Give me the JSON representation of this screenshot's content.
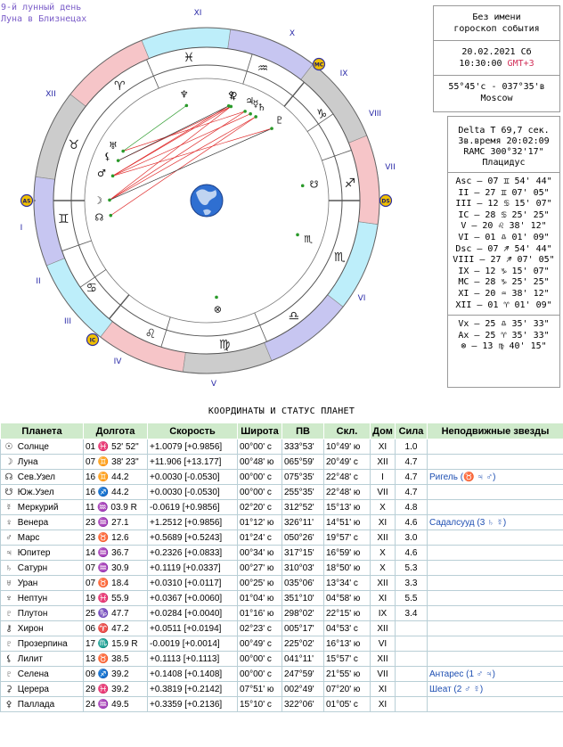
{
  "lunar_day": "9-й лунный день",
  "moon_sign": "Луна в Близнецах",
  "event": {
    "name_line1": "Без имени",
    "name_line2": "гороскоп события",
    "date": "20.02.2021 Сб",
    "time": "10:30:00",
    "tz": "GMT+3",
    "coords": "55°45'c - 037°35'в",
    "city": "Moscow"
  },
  "info": {
    "delta_t": "Delta T  69,7 сек.",
    "sidereal": "Зв.время 20:02:09",
    "ramc": "RAMC 300°32'17\"",
    "system": "Плацидус",
    "cusps": [
      "Asc – 07 ♊ 54' 44\"",
      "II – 27 ♊ 07' 05\"",
      "III – 12 ♋ 15' 07\"",
      "IC – 28 ♋ 25' 25\"",
      "V – 20 ♌ 38' 12\"",
      "VI – 01 ♎ 01' 09\"",
      "Dsc – 07 ♐ 54' 44\"",
      "VIII – 27 ♐ 07' 05\"",
      "IX – 12 ♑ 15' 07\"",
      "MC – 28 ♑ 25' 25\"",
      "XI – 20 ♒ 38' 12\"",
      "XII – 01 ♈ 01' 09\""
    ],
    "extra": [
      "Vx – 25 ♎ 35' 33\"",
      "Ax – 25 ♈ 35' 33\"",
      "⊗ – 13 ♍ 40' 15\""
    ]
  },
  "chart": {
    "house_numerals": [
      "XI",
      "X",
      "IX",
      "VIII",
      "VII",
      "VI",
      "V",
      "IV",
      "III",
      "II",
      "I",
      "XII"
    ],
    "axis_labels": {
      "asc": "AS",
      "dsc": "DS",
      "mc": "MC",
      "ic": "IC"
    },
    "colors": {
      "fire": "#f6c5c8",
      "earth": "#cccccc",
      "air": "#c7c6f1",
      "water": "#bdeefa",
      "accent": "#f0c000",
      "aspect_red": "#e03030",
      "aspect_black": "#333333",
      "aspect_green": "#2a9a2a",
      "numeral": "#2a2aa8"
    }
  },
  "table_title": "КООРДИНАТЫ И СТАТУС ПЛАНЕТ",
  "columns": [
    "Планета",
    "Долгота",
    "Скорость",
    "Широта",
    "ПВ",
    "Скл.",
    "Дом",
    "Сила",
    "Неподвижные звезды"
  ],
  "planets": [
    {
      "glyph": "☉",
      "name": "Солнце",
      "lon": "01 ♓ 52' 52\"",
      "speed": "+1.0079 [+0.9856]",
      "lat": "00°00' с",
      "ra": "333°53'",
      "decl": "10°49' ю",
      "house": "XI",
      "power": "1.0",
      "stars": ""
    },
    {
      "glyph": "☽",
      "name": "Луна",
      "lon": "07 ♊ 38' 23\"",
      "speed": "+11.906 [+13.177]",
      "lat": "00°48' ю",
      "ra": "065°59'",
      "decl": "20°49' с",
      "house": "XII",
      "power": "4.7",
      "stars": ""
    },
    {
      "glyph": "☊",
      "name": "Сев.Узел",
      "lon": "16 ♊ 44.2",
      "speed": "+0.0030 [-0.0530]",
      "lat": "00°00' с",
      "ra": "075°35'",
      "decl": "22°48' с",
      "house": "I",
      "power": "4.7",
      "stars": "Ригель (♉ ♃ ♂)"
    },
    {
      "glyph": "☋",
      "name": "Юж.Узел",
      "lon": "16 ♐ 44.2",
      "speed": "+0.0030 [-0.0530]",
      "lat": "00°00' с",
      "ra": "255°35'",
      "decl": "22°48' ю",
      "house": "VII",
      "power": "4.7",
      "stars": ""
    },
    {
      "glyph": "☿",
      "name": "Меркурий",
      "lon": "11 ♒ 03.9  R",
      "speed": "-0.0619 [+0.9856]",
      "lat": "02°20' с",
      "ra": "312°52'",
      "decl": "15°13' ю",
      "house": "X",
      "power": "4.8",
      "stars": ""
    },
    {
      "glyph": "♀",
      "name": "Венера",
      "lon": "23 ♒ 27.1",
      "speed": "+1.2512 [+0.9856]",
      "lat": "01°12' ю",
      "ra": "326°11'",
      "decl": "14°51' ю",
      "house": "XI",
      "power": "4.6",
      "stars": "Садалсууд (3 ♄ ☿)"
    },
    {
      "glyph": "♂",
      "name": "Марс",
      "lon": "23 ♉ 12.6",
      "speed": "+0.5689 [+0.5243]",
      "lat": "01°24' с",
      "ra": "050°26'",
      "decl": "19°57' с",
      "house": "XII",
      "power": "3.0",
      "stars": ""
    },
    {
      "glyph": "♃",
      "name": "Юпитер",
      "lon": "14 ♒ 36.7",
      "speed": "+0.2326 [+0.0833]",
      "lat": "00°34' ю",
      "ra": "317°15'",
      "decl": "16°59' ю",
      "house": "X",
      "power": "4.6",
      "stars": ""
    },
    {
      "glyph": "♄",
      "name": "Сатурн",
      "lon": "07 ♒ 30.9",
      "speed": "+0.1119 [+0.0337]",
      "lat": "00°27' ю",
      "ra": "310°03'",
      "decl": "18°50' ю",
      "house": "X",
      "power": "5.3",
      "stars": ""
    },
    {
      "glyph": "♅",
      "name": "Уран",
      "lon": "07 ♉ 18.4",
      "speed": "+0.0310 [+0.0117]",
      "lat": "00°25' ю",
      "ra": "035°06'",
      "decl": "13°34' с",
      "house": "XII",
      "power": "3.3",
      "stars": ""
    },
    {
      "glyph": "♆",
      "name": "Нептун",
      "lon": "19 ♓ 55.9",
      "speed": "+0.0367 [+0.0060]",
      "lat": "01°04' ю",
      "ra": "351°10'",
      "decl": "04°58' ю",
      "house": "XI",
      "power": "5.5",
      "stars": ""
    },
    {
      "glyph": "♇",
      "name": "Плутон",
      "lon": "25 ♑ 47.7",
      "speed": "+0.0284 [+0.0040]",
      "lat": "01°16' ю",
      "ra": "298°02'",
      "decl": "22°15' ю",
      "house": "IX",
      "power": "3.4",
      "stars": ""
    },
    {
      "glyph": "⚷",
      "name": "Хирон",
      "lon": "06 ♈ 47.2",
      "speed": "+0.0511 [+0.0194]",
      "lat": "02°23' с",
      "ra": "005°17'",
      "decl": "04°53' с",
      "house": "XII",
      "power": "",
      "stars": ""
    },
    {
      "glyph": "♇",
      "name": "Прозерпина",
      "lon": "17 ♏ 15.9  R",
      "speed": "-0.0019 [+0.0014]",
      "lat": "00°49' с",
      "ra": "225°02'",
      "decl": "16°13' ю",
      "house": "VI",
      "power": "",
      "stars": ""
    },
    {
      "glyph": "⚸",
      "name": "Лилит",
      "lon": "13 ♉ 38.5",
      "speed": "+0.1113 [+0.1113]",
      "lat": "00°00' с",
      "ra": "041°11'",
      "decl": "15°57' с",
      "house": "XII",
      "power": "",
      "stars": ""
    },
    {
      "glyph": "♇",
      "name": "Селена",
      "lon": "09 ♐ 39.2",
      "speed": "+0.1408 [+0.1408]",
      "lat": "00°00' с",
      "ra": "247°59'",
      "decl": "21°55' ю",
      "house": "VII",
      "power": "",
      "stars": "Антарес (1 ♂ ♃)"
    },
    {
      "glyph": "⚳",
      "name": "Церера",
      "lon": "29 ♓ 39.2",
      "speed": "+0.3819 [+0.2142]",
      "lat": "07°51' ю",
      "ra": "002°49'",
      "decl": "07°20' ю",
      "house": "XI",
      "power": "",
      "stars": "Шеат (2 ♂ ☿)"
    },
    {
      "glyph": "⚴",
      "name": "Паллада",
      "lon": "24 ♒ 49.5",
      "speed": "+0.3359 [+0.2136]",
      "lat": "15°10' с",
      "ra": "322°06'",
      "decl": "01°05' с",
      "house": "XI",
      "power": "",
      "stars": ""
    }
  ]
}
